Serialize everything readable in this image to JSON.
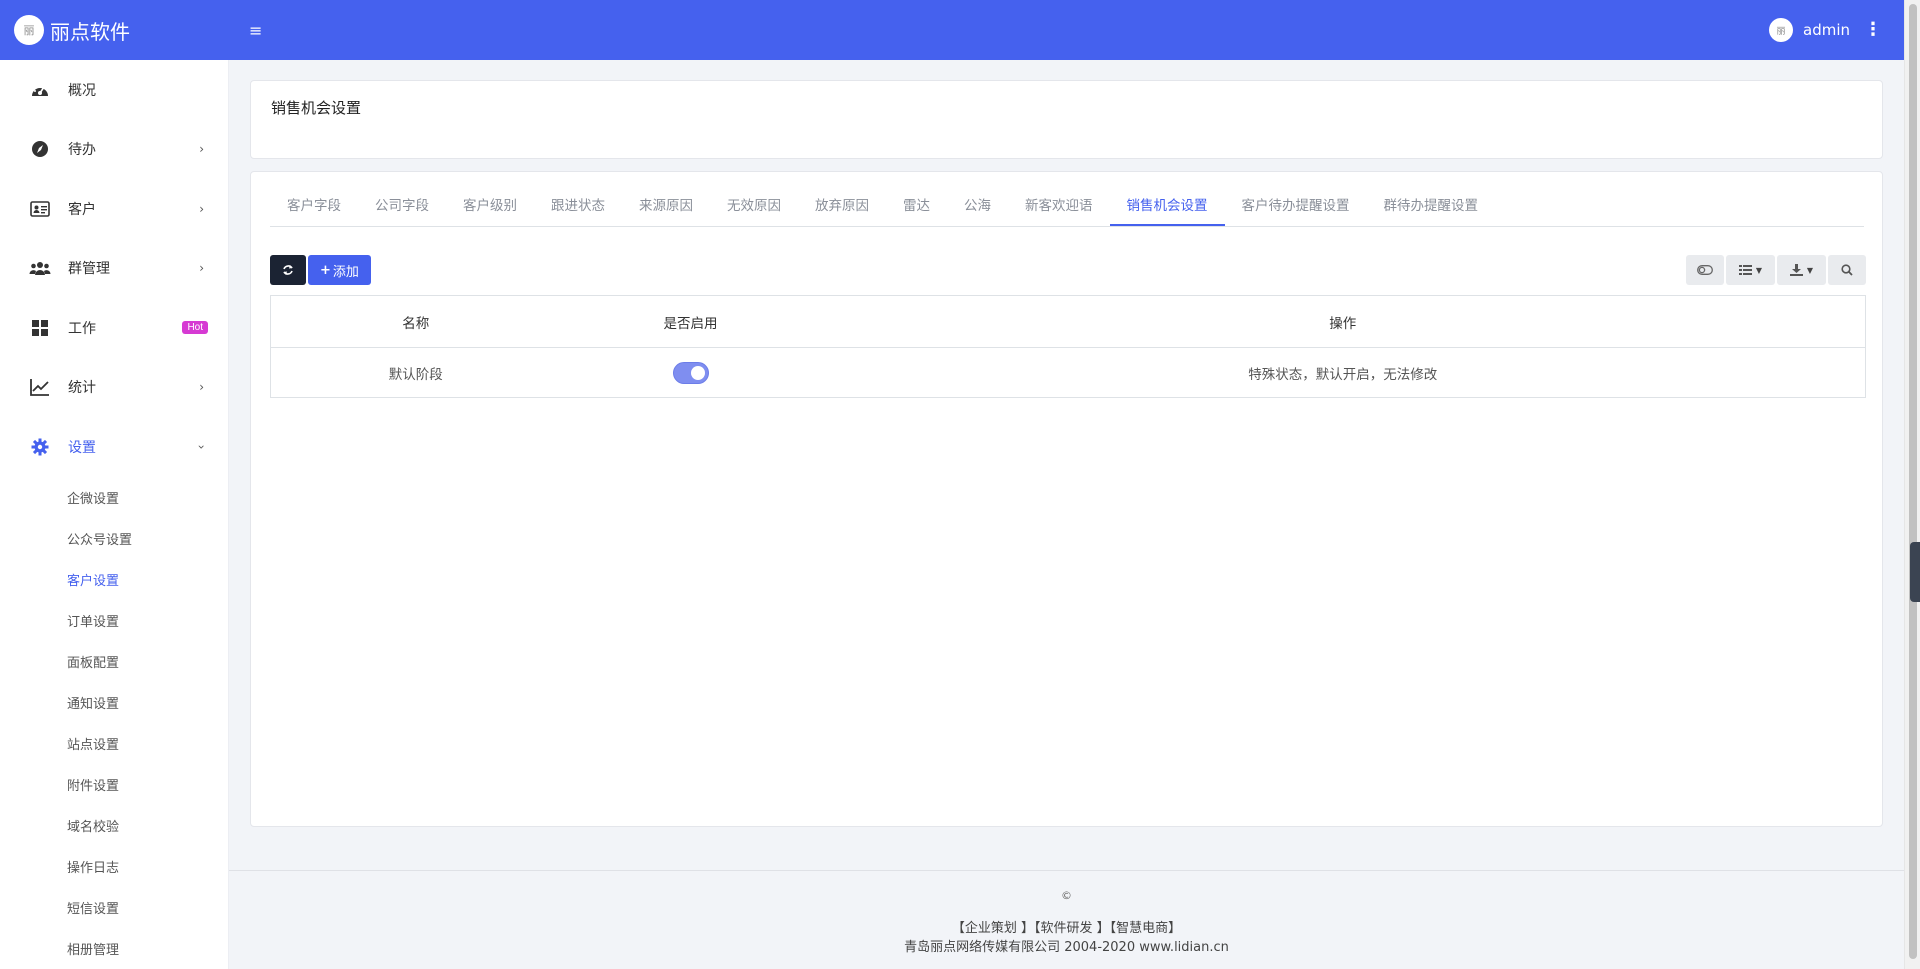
{
  "header": {
    "brand": "丽点软件",
    "logo_text": "丽",
    "user": "admin",
    "menu_icon": "hamburger-icon",
    "more_icon": "more-vertical-icon"
  },
  "sidebar": {
    "items": [
      {
        "label": "概况",
        "icon": "dashboard-icon"
      },
      {
        "label": "待办",
        "icon": "compass-icon"
      },
      {
        "label": "客户",
        "icon": "id-card-icon"
      },
      {
        "label": "群管理",
        "icon": "users-icon"
      },
      {
        "label": "工作",
        "icon": "grid-icon",
        "badge": "Hot"
      },
      {
        "label": "统计",
        "icon": "chart-line-icon"
      },
      {
        "label": "设置",
        "icon": "gear-icon"
      }
    ],
    "settings_sub": [
      "企微设置",
      "公众号设置",
      "客户设置",
      "订单设置",
      "面板配置",
      "通知设置",
      "站点设置",
      "附件设置",
      "域名校验",
      "操作日志",
      "短信设置",
      "相册管理"
    ]
  },
  "page": {
    "title": "销售机会设置"
  },
  "tabs": [
    "客户字段",
    "公司字段",
    "客户级别",
    "跟进状态",
    "来源原因",
    "无效原因",
    "放弃原因",
    "雷达",
    "公海",
    "新客欢迎语",
    "销售机会设置",
    "客户待办提醒设置",
    "群待办提醒设置"
  ],
  "toolbar": {
    "add_label": "添加",
    "plus": "+"
  },
  "table": {
    "headers": {
      "name": "名称",
      "enabled": "是否启用",
      "action": "操作"
    },
    "rows": [
      {
        "name": "默认阶段",
        "enabled": true,
        "action": "特殊状态，默认开启，无法修改"
      }
    ]
  },
  "footer": {
    "symbol": "©",
    "links": "【企业策划 】【软件研发 】【智慧电商】",
    "copyright": "青岛丽点网络传媒有限公司 2004-2020 www.lidian.cn"
  },
  "colors": {
    "primary": "#4561ee",
    "dark_button": "#1b2333",
    "hot_badge": "#d63ad3"
  }
}
